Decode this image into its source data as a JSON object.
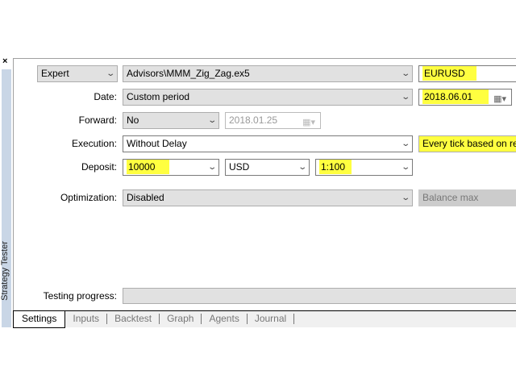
{
  "panel_title": "Strategy Tester",
  "close_icon": "×",
  "expert": {
    "type": "Expert",
    "file": "Advisors\\MMM_Zig_Zag.ex5",
    "symbol": "EURUSD"
  },
  "date": {
    "label": "Date:",
    "value": "Custom period",
    "to": "2018.06.01"
  },
  "forward": {
    "label": "Forward:",
    "value": "No",
    "date": "2018.01.25"
  },
  "execution": {
    "label": "Execution:",
    "value": "Without Delay",
    "model": "Every tick based on real ticks"
  },
  "deposit": {
    "label": "Deposit:",
    "value": "10000",
    "currency": "USD",
    "leverage": "1:100"
  },
  "optimization": {
    "label": "Optimization:",
    "value": "Disabled",
    "criterion": "Balance max"
  },
  "progress": {
    "label": "Testing progress:",
    "value": 0
  },
  "tabs": [
    "Settings",
    "Inputs",
    "Backtest",
    "Graph",
    "Agents",
    "Journal"
  ],
  "highlight_color": "#ffff40"
}
